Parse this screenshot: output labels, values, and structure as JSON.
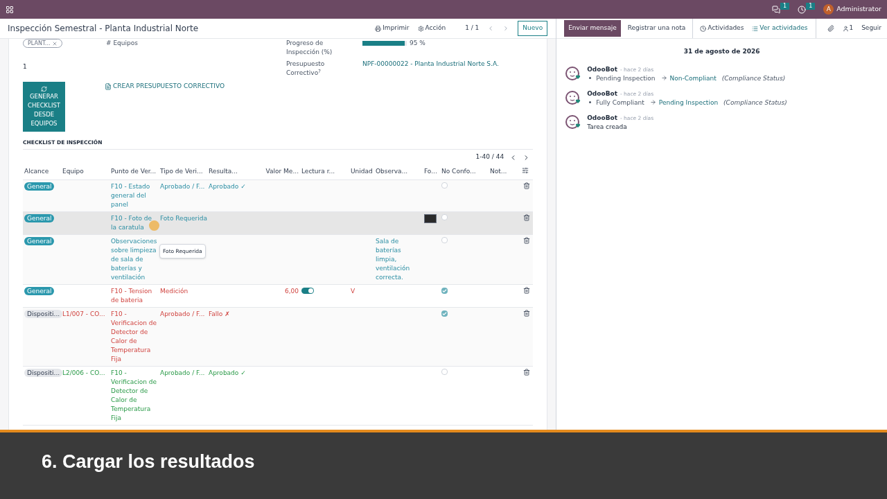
{
  "navbar": {
    "notifications": [
      {
        "kind": "chat",
        "count": "1"
      },
      {
        "kind": "activity",
        "count": "1"
      }
    ],
    "user": {
      "initial": "A",
      "name": "Administrator"
    }
  },
  "header": {
    "title": "Inspección Semestral - Planta Industrial Norte",
    "print": "Imprimir",
    "action": "Acción",
    "pager": "1 / 1",
    "new_button": "Nuevo"
  },
  "form": {
    "tag": "PLANT...",
    "equipos_label": "# Equipos",
    "equipos_value": "1",
    "progress_label": "Progreso de Inspección (%)",
    "progress": {
      "level": 0.95,
      "reading": "95 %"
    },
    "budget_label": "Presupuesto Correctivo",
    "budget_help": "?",
    "budget_value": "NPF-00000022 - Planta Industrial Norte S.A.",
    "generate_button": "GENERAR CHECKLIST DESDE EQUIPOS",
    "create_button": "CREAR PRESUPUESTO CORRECTIVO",
    "section_title": "CHECKLIST DE INSPECCIÓN",
    "pager": "1-40 / 44"
  },
  "table": {
    "columns": [
      "Alcance",
      "Equipo",
      "Punto de Ver...",
      "Tipo de Veri...",
      "Resulta...",
      "Valor Me...",
      "Lectura r...",
      "Unidad",
      "Observa...",
      "Fo...",
      "No Confo...",
      "Not..."
    ],
    "rows": [
      {
        "scope": "General",
        "kind": "general",
        "equipo": "",
        "punto": "F10 - Estado general del panel",
        "tipo": "Aprobado / F...",
        "resultado": "Aprobado ✓",
        "valor": "",
        "lectura": false,
        "unidad": "",
        "observacion": "",
        "photo": false,
        "non_conforming": false,
        "failed": false,
        "passed": false,
        "hovered": false
      },
      {
        "scope": "General",
        "kind": "general",
        "equipo": "",
        "punto": "F10 - Foto de la caratula",
        "tipo": "Foto Requerida",
        "resultado": "",
        "valor": "",
        "lectura": false,
        "unidad": "",
        "observacion": "",
        "photo": true,
        "non_conforming": false,
        "failed": false,
        "passed": false,
        "hovered": true
      },
      {
        "scope": "General",
        "kind": "general",
        "equipo": "",
        "punto": "Observaciones sobre limpieza de sala de baterías y ventilación",
        "tipo": "",
        "resultado": "",
        "valor": "",
        "lectura": false,
        "unidad": "",
        "observacion": "Sala de baterías limpia, ventilación correcta.",
        "photo": false,
        "non_conforming": false,
        "failed": false,
        "passed": false,
        "hovered": false
      },
      {
        "scope": "General",
        "kind": "general",
        "equipo": "",
        "punto": "F10 - Tension de bateria",
        "tipo": "Medición",
        "resultado": "",
        "valor": "6,00",
        "lectura": true,
        "unidad": "V",
        "observacion": "",
        "photo": false,
        "non_conforming": true,
        "failed": true,
        "passed": false,
        "hovered": false
      },
      {
        "scope": "Dispositi...",
        "kind": "device",
        "equipo": "L1/007 - CO...",
        "punto": "F10 - Verificacion de Detector de Calor de Temperatura Fija",
        "tipo": "Aprobado / F...",
        "resultado": "Fallo ✗",
        "valor": "",
        "lectura": false,
        "unidad": "",
        "observacion": "",
        "photo": false,
        "non_conforming": true,
        "failed": true,
        "passed": false,
        "hovered": false
      },
      {
        "scope": "Dispositi...",
        "kind": "device",
        "equipo": "L2/006 - CO...",
        "punto": "F10 - Verificacion de Detector de Calor de Temperatura Fija",
        "tipo": "Aprobado / F...",
        "resultado": "Aprobado ✓",
        "valor": "",
        "lectura": false,
        "unidad": "",
        "observacion": "",
        "photo": false,
        "non_conforming": false,
        "failed": false,
        "passed": true,
        "hovered": false
      }
    ]
  },
  "tooltip": "Foto Requerida",
  "chatter": {
    "send": "Enviar mensaje",
    "note": "Registrar una nota",
    "activities": "Actividades",
    "view_activities": "Ver actividades",
    "followers": "1",
    "follow": "Seguir",
    "date": "31 de agosto de 2026",
    "messages": [
      {
        "author": "OdooBot",
        "time": "- hace 2 días",
        "kind": "change",
        "old": "Pending Inspection",
        "new": "Non-Compliant",
        "field": "(Compliance Status)"
      },
      {
        "author": "OdooBot",
        "time": "- hace 2 días",
        "kind": "change",
        "old": "Fully Compliant",
        "new": "Pending Inspection",
        "field": "(Compliance Status)"
      },
      {
        "author": "OdooBot",
        "time": "- hace 2 días",
        "kind": "text",
        "body": "Tarea creada"
      }
    ]
  },
  "caption": "6. Cargar los resultados"
}
